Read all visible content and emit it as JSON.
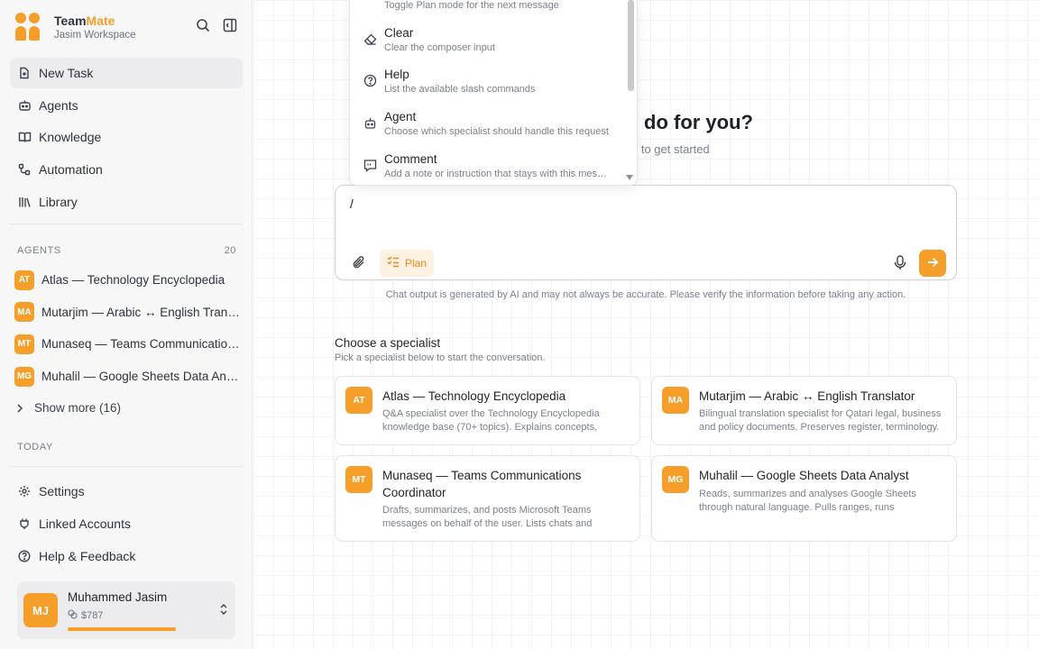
{
  "brand": {
    "name_part1": "Team",
    "name_part2": "Mate",
    "workspace": "Jasim Workspace"
  },
  "nav": {
    "items": [
      {
        "label": "New Task",
        "icon": "new-task-icon"
      },
      {
        "label": "Agents",
        "icon": "agents-icon"
      },
      {
        "label": "Knowledge",
        "icon": "book-icon"
      },
      {
        "label": "Automation",
        "icon": "automation-icon"
      },
      {
        "label": "Library",
        "icon": "library-icon"
      }
    ]
  },
  "agents_section": {
    "heading": "AGENTS",
    "count": "20",
    "items": [
      {
        "initials": "AT",
        "name": "Atlas — Technology Encyclopedia"
      },
      {
        "initials": "MA",
        "name": "Mutarjim — Arabic ↔ English Translator"
      },
      {
        "initials": "MT",
        "name": "Munaseq — Teams Communications Coordinator"
      },
      {
        "initials": "MG",
        "name": "Muhalil — Google Sheets Data Analyst"
      }
    ],
    "show_more": "Show more (16)"
  },
  "today_section": {
    "heading": "TODAY"
  },
  "bottom_nav": {
    "items": [
      {
        "label": "Settings",
        "icon": "gear-icon"
      },
      {
        "label": "Linked Accounts",
        "icon": "plug-icon"
      },
      {
        "label": "Help & Feedback",
        "icon": "help-icon"
      }
    ]
  },
  "user": {
    "initials": "MJ",
    "name": "Muhammed Jasim",
    "credits": "$787",
    "usage_fraction": 0.8
  },
  "hero": {
    "title_visible": "do for you?",
    "subtitle_visible": "g to get started"
  },
  "composer": {
    "value": "/",
    "plan_label": "Plan"
  },
  "disclaimer": "Chat output is generated by AI and may not always be accurate. Please verify the information before taking any action.",
  "specialists": {
    "title": "Choose a specialist",
    "subtitle": "Pick a specialist below to start the conversation.",
    "cards": [
      {
        "initials": "AT",
        "title": "Atlas — Technology Encyclopedia",
        "desc": "Q&A specialist over the Technology Encyclopedia knowledge base (70+ topics). Explains concepts, compares technologies."
      },
      {
        "initials": "MA",
        "title": "Mutarjim — Arabic ↔ English Translator",
        "desc": "Bilingual translation specialist for Qatari legal, business and policy documents. Preserves register, terminology."
      },
      {
        "initials": "MT",
        "title": "Munaseq — Teams Communications Coordinator",
        "desc": "Drafts, summarizes, and posts Microsoft Teams messages on behalf of the user. Lists chats and channels."
      },
      {
        "initials": "MG",
        "title": "Muhalil — Google Sheets Data Analyst",
        "desc": "Reads, summarizes and analyses Google Sheets through natural language. Pulls ranges, runs calculations."
      }
    ]
  },
  "slash_menu": {
    "partial_hint": "Toggle Plan mode for the next message",
    "commands": [
      {
        "label": "Clear",
        "hint": "Clear the composer input",
        "icon": "eraser-icon"
      },
      {
        "label": "Help",
        "hint": "List the available slash commands",
        "icon": "help-circle-icon"
      },
      {
        "label": "Agent",
        "hint": "Choose which specialist should handle this request",
        "icon": "bot-icon"
      },
      {
        "label": "Comment",
        "hint": "Add a note or instruction that stays with this message",
        "icon": "comment-icon"
      }
    ]
  },
  "colors": {
    "accent": "#f59e2a",
    "accent_soft": "#fdf1e2",
    "sidebar_bg": "#f7f7f8",
    "text_muted": "#7b8090"
  }
}
